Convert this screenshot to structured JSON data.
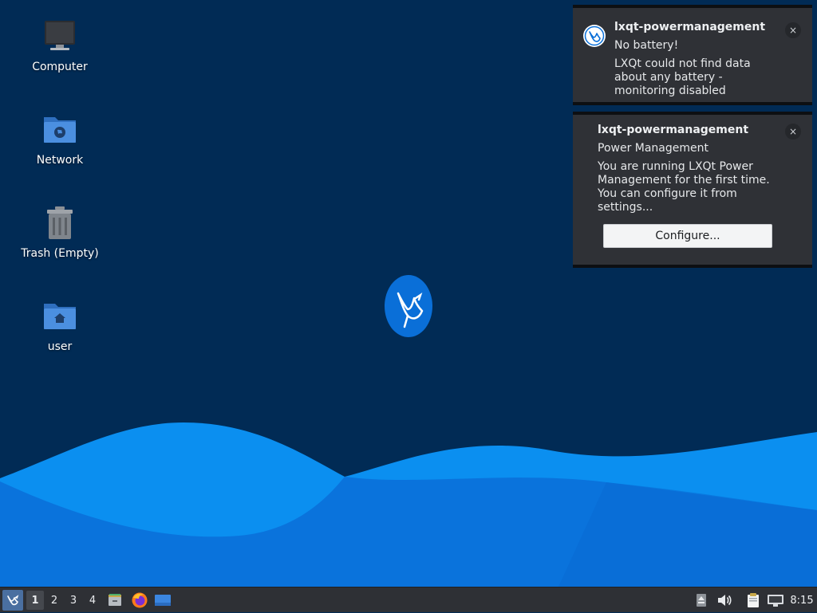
{
  "desktop": {
    "icons": [
      {
        "label": "Computer",
        "icon": "computer-icon"
      },
      {
        "label": "Network",
        "icon": "network-folder-icon"
      },
      {
        "label": "Trash (Empty)",
        "icon": "trash-icon"
      },
      {
        "label": "user",
        "icon": "home-folder-icon"
      }
    ],
    "wallpaper_logo": "lubuntu-bird-logo",
    "colors": {
      "background": "#012b55",
      "wave_light": "#0c8ff0",
      "wave_dark": "#0a6fd9"
    }
  },
  "notifications": [
    {
      "app": "lxqt-powermanagement",
      "summary": "No battery!",
      "body": "LXQt could not find data about any battery - monitoring disabled",
      "icon": "lubuntu-logo-icon",
      "close": "×"
    },
    {
      "app": "lxqt-powermanagement",
      "summary": "Power Management",
      "body": "You are running LXQt Power Management for the first time. You can configure it from settings...",
      "close": "×",
      "action_label": "Configure..."
    }
  ],
  "taskbar": {
    "start_icon": "lubuntu-start-icon",
    "workspaces": [
      "1",
      "2",
      "3",
      "4"
    ],
    "active_workspace": "1",
    "quicklaunch": [
      "file-manager-icon",
      "firefox-icon",
      "show-desktop-icon"
    ],
    "tray": [
      "eject-icon",
      "volume-icon",
      "clipboard-icon",
      "network-icon"
    ],
    "clock": "8:15"
  }
}
